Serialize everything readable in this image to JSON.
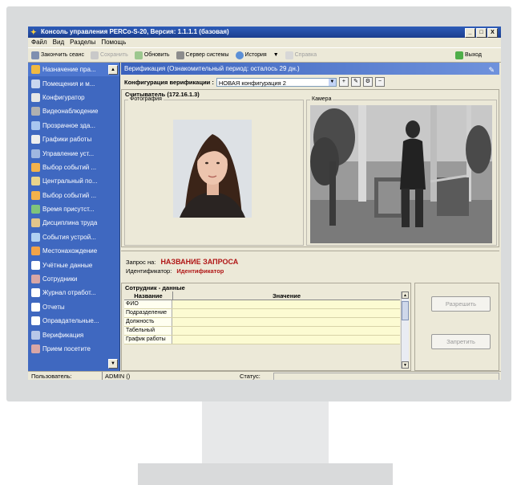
{
  "window": {
    "title": "Консоль управления PERCo-S-20, Версия: 1.1.1.1 (базовая)",
    "buttons": [
      "_",
      "□",
      "X"
    ]
  },
  "menu": [
    "Файл",
    "Вид",
    "Разделы",
    "Помощь"
  ],
  "toolbar": {
    "finish_session": "Закончить сеанс",
    "save": "Сохранить",
    "refresh": "Обновить",
    "server": "Сервер системы",
    "history": "История",
    "history_arrow": "▼",
    "help": "Справка",
    "exit": "Выход"
  },
  "sidebar": {
    "items": [
      {
        "label": "Назначение пра...",
        "icon": "key-icon",
        "color": "#f0b940"
      },
      {
        "label": "Помещения и м...",
        "icon": "building-icon",
        "color": "#c9d6ef"
      },
      {
        "label": "Конфигуратор",
        "icon": "gear-icon",
        "color": "#e6e6e6"
      },
      {
        "label": "Видеонаблюдение",
        "icon": "camera-icon",
        "color": "#b0b0b0"
      },
      {
        "label": "Прозрачное зда...",
        "icon": "building-icon",
        "color": "#a8c6f0"
      },
      {
        "label": "Графики работы",
        "icon": "calendar-icon",
        "color": "#eeeeee"
      },
      {
        "label": "Управление уст...",
        "icon": "device-icon",
        "color": "#9fb7e0"
      },
      {
        "label": "Выбор событий ...",
        "icon": "events-icon",
        "color": "#f3b24b"
      },
      {
        "label": "Центральный по...",
        "icon": "people-icon",
        "color": "#e9d48b"
      },
      {
        "label": "Выбор событий ...",
        "icon": "events-icon",
        "color": "#f3b24b"
      },
      {
        "label": "Время присутст...",
        "icon": "clock-icon",
        "color": "#7fc47b"
      },
      {
        "label": "Дисциплина труда",
        "icon": "person-icon",
        "color": "#e2c58b"
      },
      {
        "label": "События устрой...",
        "icon": "events-icon",
        "color": "#b0d1f2"
      },
      {
        "label": "Местонахождение",
        "icon": "location-icon",
        "color": "#f2a347"
      },
      {
        "label": "Учётные данные",
        "icon": "folder-icon",
        "color": "#ffffff"
      },
      {
        "label": "Сотрудники",
        "icon": "person-icon",
        "color": "#d8a6a6"
      },
      {
        "label": "Журнал отработ...",
        "icon": "folder-icon",
        "color": "#ffffff"
      },
      {
        "label": "Отчеты",
        "icon": "folder-icon",
        "color": "#ffffff"
      },
      {
        "label": "Оправдательные...",
        "icon": "folder-icon",
        "color": "#ffffff"
      },
      {
        "label": "Верификация",
        "icon": "verify-icon",
        "color": "#b8c7e8"
      },
      {
        "label": "Прием посетите",
        "icon": "visitor-icon",
        "color": "#d8a6a6"
      }
    ]
  },
  "header": {
    "title": "Верификация (Ознакомительный период: осталось 29 дн.)"
  },
  "config": {
    "label": "Конфигурация верификации :",
    "value": "НОВАЯ конфигурация 2"
  },
  "reader": {
    "title": "Считыватель (172.16.1.3)",
    "photo_label": "Фотография",
    "camera_label": "Камера"
  },
  "request": {
    "label": "Запрос на:",
    "name": "НАЗВАНИЕ ЗАПРОСА",
    "id_label": "Идентификатор:",
    "id_value": "Идентификатор"
  },
  "employee": {
    "title": "Сотрудник - данные",
    "columns": [
      "Название",
      "Значение"
    ],
    "rows": [
      "ФИО",
      "Подразделение",
      "Должность",
      "Табельный номер",
      "График работы"
    ]
  },
  "actions": {
    "allow": "Разрешить",
    "deny": "Запретить"
  },
  "status": {
    "user_label": "Пользователь:",
    "user_value": "ADMIN ()",
    "status_label": "Статус:"
  },
  "colors": {
    "title_bar": "#1b3e8e",
    "sidebar": "#3f68c0",
    "accent_red": "#b01616"
  }
}
